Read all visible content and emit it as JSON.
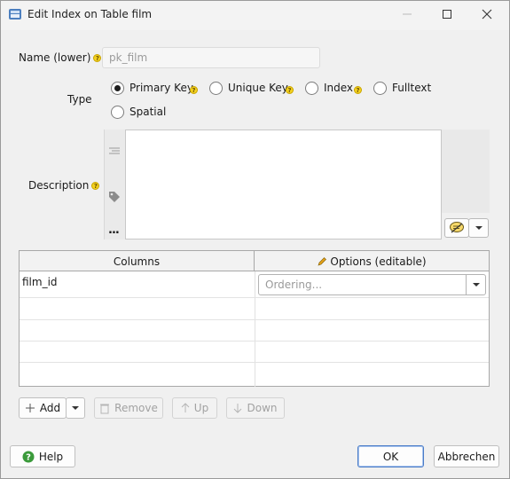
{
  "window": {
    "title": "Edit Index on Table film",
    "icon": "database-table-icon",
    "controls": [
      "minimize-icon",
      "maximize-icon",
      "close-icon"
    ]
  },
  "form": {
    "name_label": "Name (lower)",
    "name_value": "pk_film",
    "type_label": "Type",
    "type_options": [
      {
        "label": "Primary Key",
        "selected": true,
        "help": true
      },
      {
        "label": "Unique Key",
        "selected": false,
        "help": true
      },
      {
        "label": "Index",
        "selected": false,
        "help": true
      },
      {
        "label": "Fulltext",
        "selected": false,
        "help": false
      },
      {
        "label": "Spatial",
        "selected": false,
        "help": false
      }
    ],
    "description_label": "Description",
    "description_value": "",
    "more_label": "..."
  },
  "grid": {
    "columns_header": "Columns",
    "options_header": "Options (editable)",
    "rows": [
      {
        "column": "film_id",
        "options_placeholder": "Ordering..."
      }
    ]
  },
  "toolbar": {
    "add_label": "Add",
    "remove_label": "Remove",
    "up_label": "Up",
    "down_label": "Down"
  },
  "footer": {
    "help_label": "Help",
    "ok_label": "OK",
    "cancel_label": "Abbrechen"
  },
  "colors": {
    "help_badge": "#f4d21f",
    "primary_border": "#4a7cc7",
    "help_icon": "#3a9a3a"
  }
}
